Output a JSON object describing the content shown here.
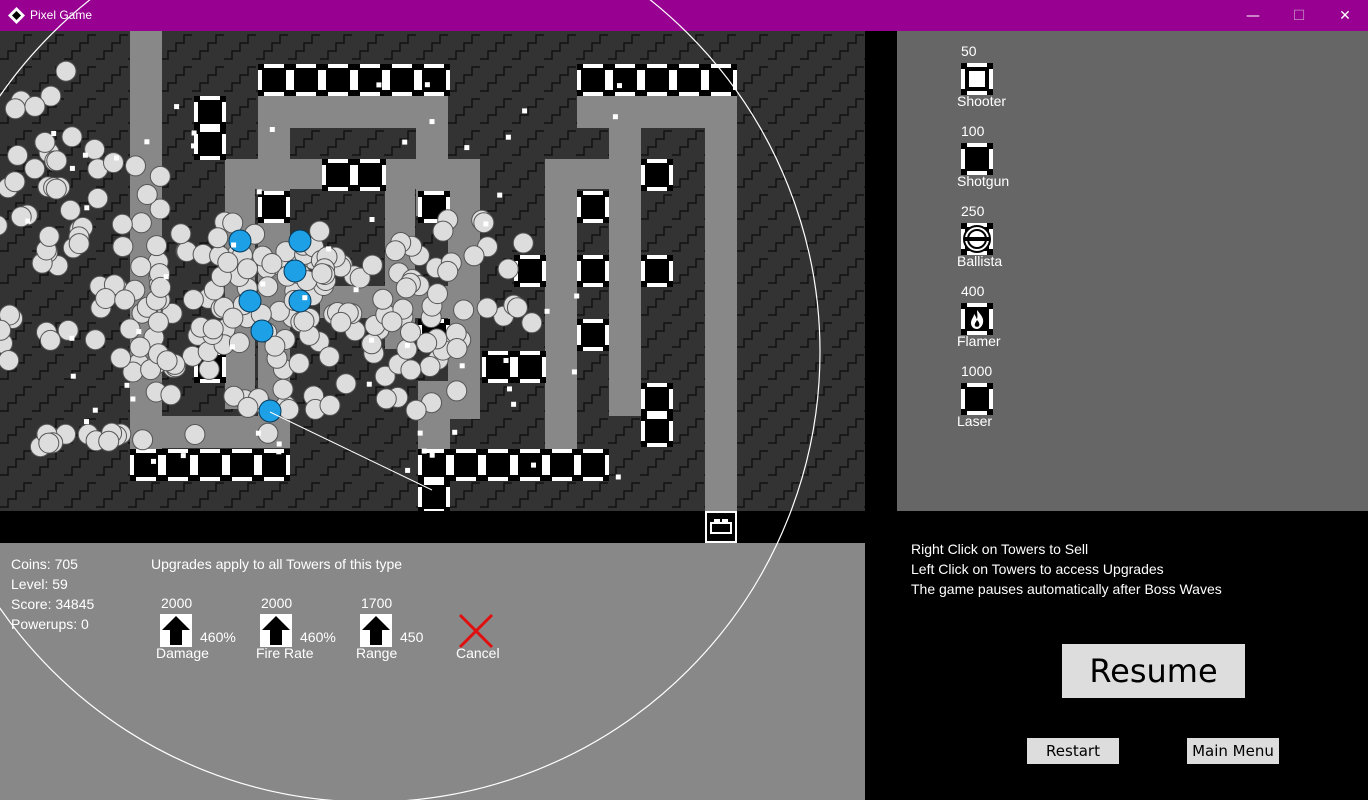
{
  "window": {
    "title": "Pixel Game",
    "minimize": "—",
    "maximize": "☐",
    "close": "✕"
  },
  "colors": {
    "titlebar": "#970091",
    "board_bg": "#333333",
    "path": "#888888",
    "shop_bg": "#666666",
    "panel_bg": "#888888",
    "enemy": "#dddddd",
    "enemy_frozen": "#1ea0e6",
    "cancel": "#e01010"
  },
  "shop": {
    "items": [
      {
        "price": "50",
        "name": "Shooter",
        "icon": "shooter-tower-icon"
      },
      {
        "price": "100",
        "name": "Shotgun",
        "icon": "shotgun-tower-icon"
      },
      {
        "price": "250",
        "name": "Ballista",
        "icon": "ballista-tower-icon"
      },
      {
        "price": "400",
        "name": "Flamer",
        "icon": "flamer-tower-icon"
      },
      {
        "price": "1000",
        "name": "Laser",
        "icon": "laser-tower-icon"
      }
    ]
  },
  "stats": {
    "coins": "Coins: 705",
    "level": "Level: 59",
    "score": "Score: 34845",
    "powerups": "Powerups: 0"
  },
  "upgrades": {
    "note": "Upgrades apply to all Towers of this type",
    "items": [
      {
        "cost": "2000",
        "value": "460%",
        "label": "Damage"
      },
      {
        "cost": "2000",
        "value": "460%",
        "label": "Fire Rate"
      },
      {
        "cost": "1700",
        "value": "450",
        "label": "Range"
      }
    ],
    "cancel": "Cancel"
  },
  "hints": [
    "Right Click on Towers to Sell",
    "Left Click on Towers to access Upgrades",
    "The game pauses automatically after Boss Waves"
  ],
  "buttons": {
    "resume": "Resume",
    "restart": "Restart",
    "main_menu": "Main Menu"
  }
}
